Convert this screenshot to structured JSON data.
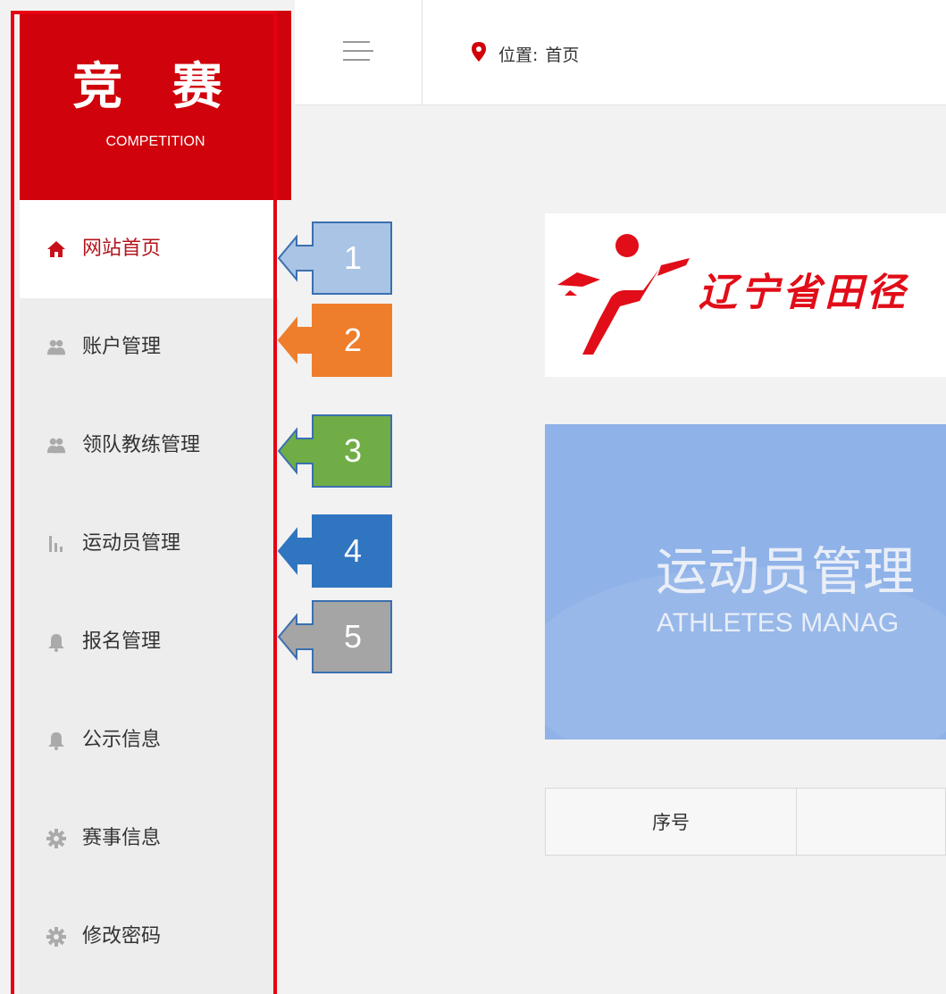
{
  "brand": {
    "title": "竞 赛",
    "subtitle": "COMPETITION"
  },
  "nav": {
    "items": [
      {
        "label": "网站首页",
        "icon": "home-icon",
        "active": true
      },
      {
        "label": "账户管理",
        "icon": "users-icon"
      },
      {
        "label": "领队教练管理",
        "icon": "users-icon"
      },
      {
        "label": "运动员管理",
        "icon": "bar-chart-icon"
      },
      {
        "label": "报名管理",
        "icon": "bell-icon"
      },
      {
        "label": "公示信息",
        "icon": "bell-icon"
      },
      {
        "label": "赛事信息",
        "icon": "gear-icon"
      },
      {
        "label": "修改密码",
        "icon": "gear-icon"
      }
    ]
  },
  "header": {
    "location_label": "位置:",
    "location_value": "首页"
  },
  "banner": {
    "title": "辽宁省田径"
  },
  "hero": {
    "title": "运动员管理",
    "subtitle": "ATHLETES MANAG"
  },
  "table": {
    "headers": [
      "序号"
    ]
  },
  "callouts": [
    {
      "label": "1",
      "color": "#a9c4e4"
    },
    {
      "label": "2",
      "color": "#ef7e2c"
    },
    {
      "label": "3",
      "color": "#70ad47"
    },
    {
      "label": "4",
      "color": "#2f75c0"
    },
    {
      "label": "5",
      "color": "#a5a5a5"
    }
  ],
  "colors": {
    "brand": "#d0020b",
    "highlight_frame": "#e60012"
  }
}
